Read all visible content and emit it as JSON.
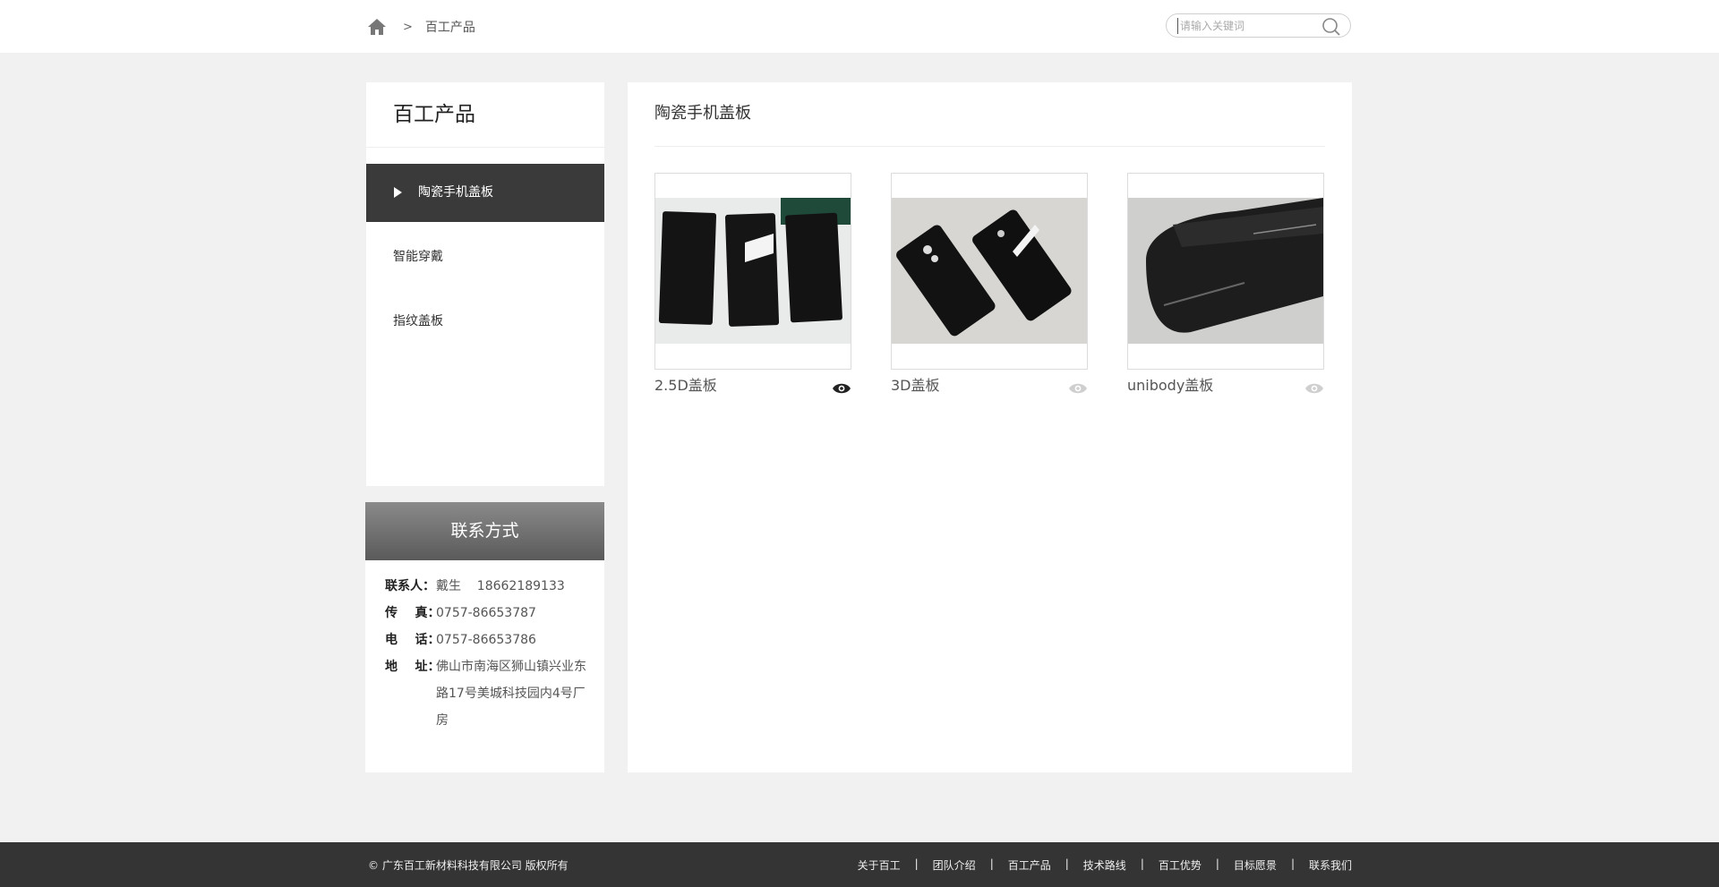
{
  "breadcrumb": {
    "current": "百工产品",
    "separator": ">"
  },
  "search": {
    "placeholder": "请输入关键词"
  },
  "sidebar": {
    "title": "百工产品",
    "items": [
      {
        "label": "陶瓷手机盖板",
        "active": true
      },
      {
        "label": "智能穿戴",
        "active": false
      },
      {
        "label": "指纹盖板",
        "active": false
      }
    ]
  },
  "contact": {
    "title": "联系方式",
    "rows": [
      {
        "label": "联系人：",
        "value": "戴生    18662189133"
      },
      {
        "label": "传    真：",
        "value": "0757-86653787"
      },
      {
        "label": "电    话：",
        "value": "0757-86653786"
      },
      {
        "label": "地    址：",
        "value": "佛山市南海区狮山镇兴业东路17号美城科技园内4号厂房"
      }
    ]
  },
  "main": {
    "title": "陶瓷手机盖板",
    "products": [
      {
        "name": "2.5D盖板",
        "eye_active": true
      },
      {
        "name": "3D盖板",
        "eye_active": false
      },
      {
        "name": "unibody盖板",
        "eye_active": false
      }
    ]
  },
  "footer": {
    "copyright": "© 广东百工新材料科技有限公司 版权所有",
    "links": [
      "关于百工",
      "团队介绍",
      "百工产品",
      "技术路线",
      "百工优势",
      "目标愿景",
      "联系我们"
    ],
    "separator": "|"
  },
  "colors": {
    "sidebar_active_bg": "#3a3a3a",
    "footer_bg": "#343434",
    "page_bg": "#f1f1f1"
  },
  "icons": [
    "home-icon",
    "search-icon",
    "eye-icon",
    "play-triangle-icon"
  ]
}
